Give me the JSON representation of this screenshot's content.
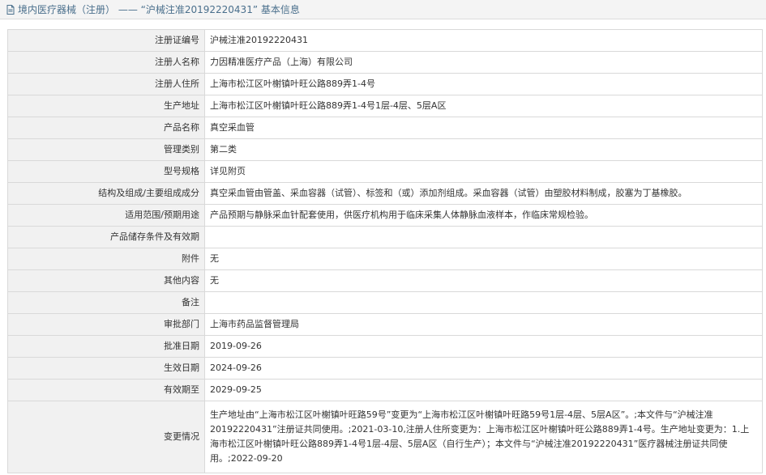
{
  "header": {
    "title": "境内医疗器械（注册） —— “沪械注准20192220431” 基本信息"
  },
  "rows": [
    {
      "label": "注册证编号",
      "value": "沪械注准20192220431"
    },
    {
      "label": "注册人名称",
      "value": "力因精准医疗产品（上海）有限公司"
    },
    {
      "label": "注册人住所",
      "value": "上海市松江区叶榭镇叶旺公路889弄1-4号"
    },
    {
      "label": "生产地址",
      "value": "上海市松江区叶榭镇叶旺公路889弄1-4号1层-4层、5层A区"
    },
    {
      "label": "产品名称",
      "value": "真空采血管"
    },
    {
      "label": "管理类别",
      "value": "第二类"
    },
    {
      "label": "型号规格",
      "value": "详见附页"
    },
    {
      "label": "结构及组成/主要组成成分",
      "value": "真空采血管由管盖、采血容器（试管）、标签和（或）添加剂组成。采血容器（试管）由塑胶材料制成，胶塞为丁基橡胶。"
    },
    {
      "label": "适用范围/预期用途",
      "value": "产品预期与静脉采血针配套使用，供医疗机构用于临床采集人体静脉血液样本，作临床常规检验。"
    },
    {
      "label": "产品储存条件及有效期",
      "value": ""
    },
    {
      "label": "附件",
      "value": "无"
    },
    {
      "label": "其他内容",
      "value": "无"
    },
    {
      "label": "备注",
      "value": ""
    },
    {
      "label": "审批部门",
      "value": "上海市药品监督管理局"
    },
    {
      "label": "批准日期",
      "value": "2019-09-26"
    },
    {
      "label": "生效日期",
      "value": "2024-09-26"
    },
    {
      "label": "有效期至",
      "value": "2029-09-25"
    },
    {
      "label": "变更情况",
      "value": "生产地址由“上海市松江区叶榭镇叶旺路59号”变更为“上海市松江区叶榭镇叶旺路59号1层-4层、5层A区”。;本文件与“沪械注准20192220431”注册证共同使用。;2021-03-10,注册人住所变更为：上海市松江区叶榭镇叶旺公路889弄1-4号。生产地址变更为：1.上海市松江区叶榭镇叶旺公路889弄1-4号1层-4层、5层A区（自行生产）；本文件与“沪械注准20192220431”医疗器械注册证共同使用。;2022-09-20"
    }
  ]
}
